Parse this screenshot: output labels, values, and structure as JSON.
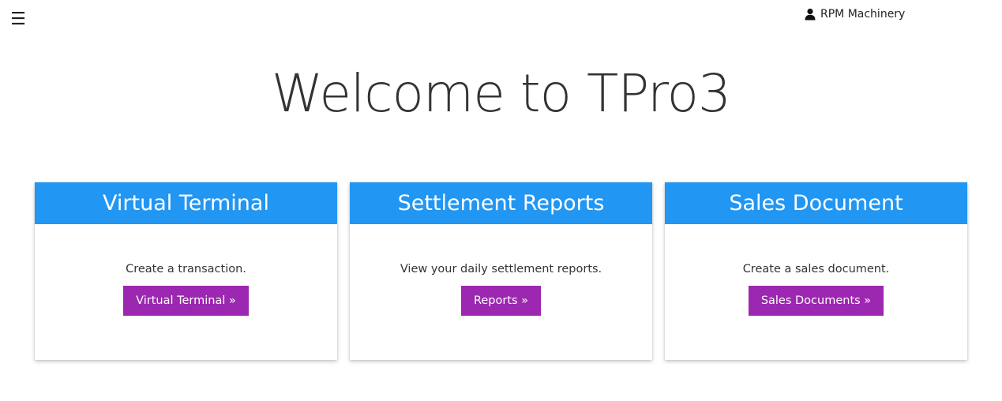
{
  "header": {
    "menu_icon": "hamburger-icon",
    "menu_glyph": "☰",
    "user_icon": "user-icon",
    "user_name": "RPM Machinery"
  },
  "main": {
    "title": "Welcome to TPro3"
  },
  "cards": [
    {
      "title": "Virtual Terminal",
      "description": "Create a transaction.",
      "button_label": "Virtual Terminal »"
    },
    {
      "title": "Settlement Reports",
      "description": "View your daily settlement reports.",
      "button_label": "Reports »"
    },
    {
      "title": "Sales Document",
      "description": "Create a sales document.",
      "button_label": "Sales Documents »"
    }
  ],
  "colors": {
    "card_header": "#2196f3",
    "button": "#9c27b0",
    "background": "#ffffff"
  }
}
